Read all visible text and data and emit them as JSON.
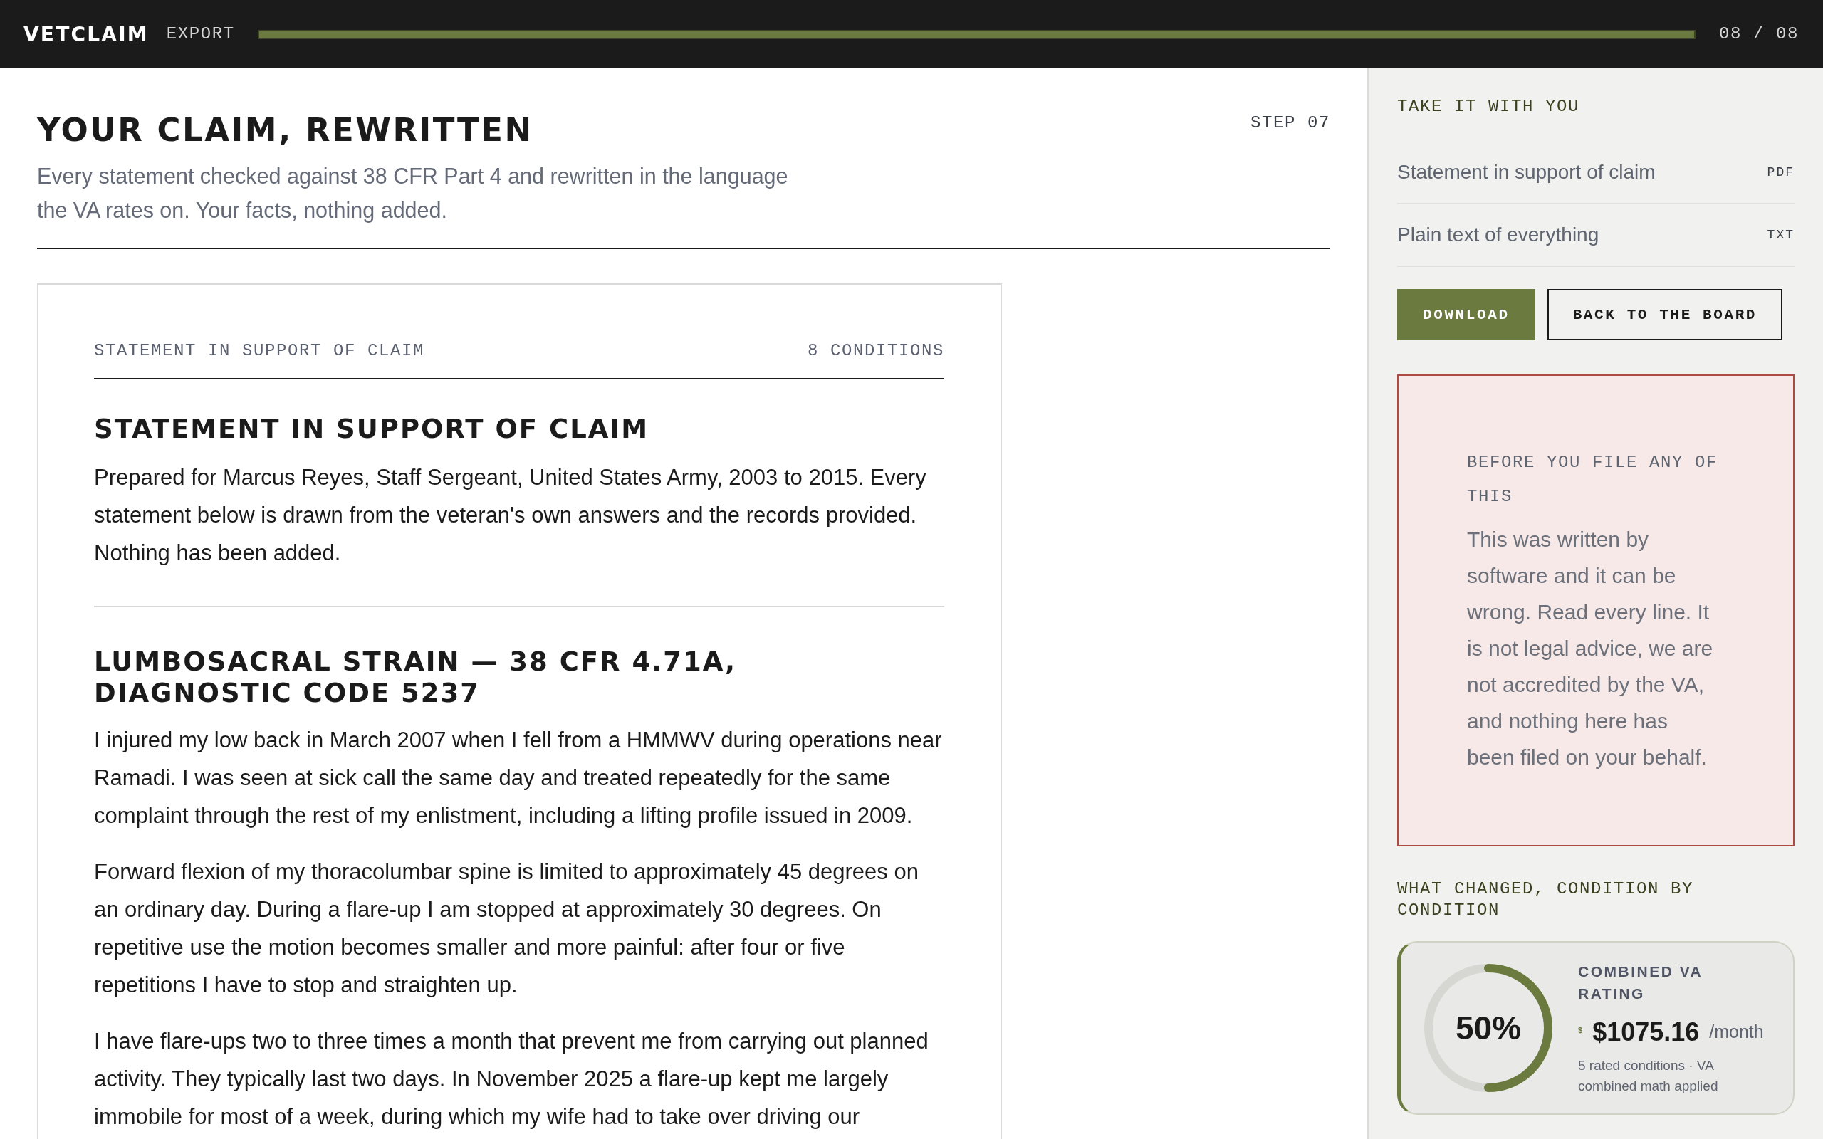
{
  "top_bar": {
    "logo": "VETCLAIM",
    "section": "EXPORT",
    "progress": {
      "level": 1.0
    },
    "step_count": "08 / 08"
  },
  "header": {
    "title": "YOUR CLAIM, REWRITTEN",
    "subtitle": "Every statement checked against 38 CFR Part 4 and rewritten in the language the VA rates on. Your facts, nothing added.",
    "step": "STEP 07"
  },
  "document": {
    "label": "STATEMENT IN SUPPORT OF CLAIM",
    "count": "8 CONDITIONS",
    "sections": [
      {
        "heading": "STATEMENT IN SUPPORT OF CLAIM",
        "paragraphs": [
          "Prepared for Marcus Reyes, Staff Sergeant, United States Army, 2003 to 2015. Every statement below is drawn from the veteran's own answers and the records provided. Nothing has been added."
        ]
      },
      {
        "heading": "LUMBOSACRAL STRAIN — 38 CFR 4.71A, DIAGNOSTIC CODE 5237",
        "paragraphs": [
          "I injured my low back in March 2007 when I fell from a HMMWV during operations near Ramadi. I was seen at sick call the same day and treated repeatedly for the same complaint through the rest of my enlistment, including a lifting profile issued in 2009.",
          "Forward flexion of my thoracolumbar spine is limited to approximately 45 degrees on an ordinary day. During a flare-up I am stopped at approximately 30 degrees. On repetitive use the motion becomes smaller and more painful: after four or five repetitions I have to stop and straighten up.",
          "I have flare-ups two to three times a month that prevent me from carrying out planned activity. They typically last two days. In November 2025 a flare-up kept me largely immobile for most of a week, during which my wife had to take over driving our"
        ]
      }
    ]
  },
  "side_panel": {
    "title": "TAKE IT WITH YOU",
    "files": [
      {
        "name": "Statement in support of claim",
        "format": "PDF"
      },
      {
        "name": "Plain text of everything",
        "format": "TXT"
      }
    ],
    "buttons": [
      {
        "label": "DOWNLOAD",
        "kind": "primary"
      },
      {
        "label": "BACK TO THE BOARD",
        "kind": "secondary"
      }
    ],
    "warning": {
      "label": "BEFORE YOU FILE ANY OF THIS",
      "text": "This was written by software and it can be wrong. Read every line. It is not legal advice, we are not accredited by the VA, and nothing here has been filed on your behalf."
    },
    "changes": {
      "title": "WHAT CHANGED, CONDITION BY CONDITION",
      "rating": {
        "level": 0.5,
        "percent": "50%",
        "label": "COMBINED VA RATING",
        "currency_mark": "$",
        "amount": "$1075.16",
        "period": "/month",
        "note": "5 rated conditions · VA combined math applied"
      }
    }
  }
}
